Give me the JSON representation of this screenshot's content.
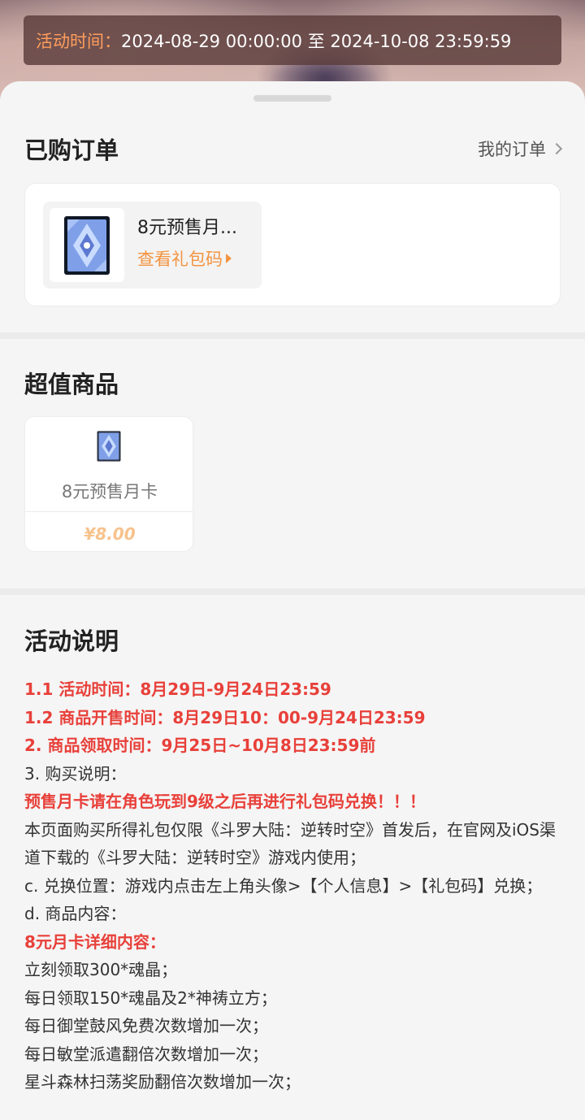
{
  "activity_time": {
    "label": "活动时间：",
    "value": "2024-08-29 00:00:00 至 2024-10-08 23:59:59"
  },
  "orders": {
    "title": "已购订单",
    "my_orders_label": "我的订单",
    "item": {
      "name": "8元预售月...",
      "link_label": "查看礼包码"
    }
  },
  "products": {
    "title": "超值商品",
    "items": [
      {
        "name": "8元预售月卡",
        "price": "¥8.00"
      }
    ]
  },
  "description": {
    "title": "活动说明",
    "lines": [
      {
        "text": "1.1 活动时间：8月29日-9月24日23:59",
        "style": "red"
      },
      {
        "text": "1.2 商品开售时间：8月29日10：00-9月24日23:59",
        "style": "red"
      },
      {
        "text": "2. 商品领取时间：9月25日~10月8日23:59前",
        "style": "red"
      },
      {
        "text": "3. 购买说明：",
        "style": "normal"
      },
      {
        "text": "预售月卡请在角色玩到9级之后再进行礼包码兑换！！！",
        "style": "red"
      },
      {
        "text": "本页面购买所得礼包仅限《斗罗大陆：逆转时空》首发后，在官网及iOS渠道下载的《斗罗大陆：逆转时空》游戏内使用；",
        "style": "normal"
      },
      {
        "text": "c. 兑换位置：游戏内点击左上角头像>【个人信息】>【礼包码】兑换；",
        "style": "normal"
      },
      {
        "text": "d. 商品内容：",
        "style": "normal"
      },
      {
        "text": "8元月卡详细内容：",
        "style": "red"
      },
      {
        "text": "立刻领取300*魂晶；",
        "style": "normal"
      },
      {
        "text": "每日领取150*魂晶及2*神祷立方；",
        "style": "normal"
      },
      {
        "text": "每日御堂鼓风免费次数增加一次；",
        "style": "normal"
      },
      {
        "text": "每日敏堂派遣翻倍次数增加一次；",
        "style": "normal"
      },
      {
        "text": "星斗森林扫荡奖励翻倍次数增加一次；",
        "style": "normal"
      }
    ]
  },
  "colors": {
    "accent_orange": "#f39441",
    "price_orange": "#f7c28c",
    "highlight_red": "#e8403a"
  },
  "icons": [
    "chevron-right-icon",
    "triangle-right-icon",
    "card-pack-icon"
  ]
}
